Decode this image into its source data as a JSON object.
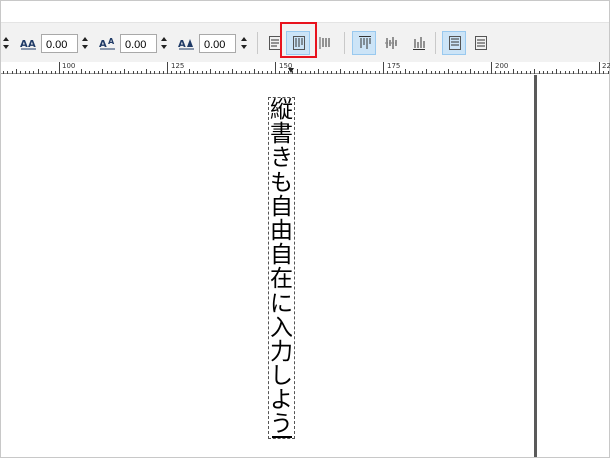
{
  "toolbar": {
    "spacing_fields": [
      {
        "name": "letter-spacing",
        "value": "0.00",
        "icon": "letter-spacing-icon"
      },
      {
        "name": "word-spacing",
        "value": "0.00",
        "icon": "word-spacing-icon"
      },
      {
        "name": "kerning",
        "value": "0.00",
        "icon": "kerning-icon"
      }
    ],
    "buttons": [
      {
        "name": "horizontal-text-button",
        "icon": "horizontal-text-icon",
        "active": false
      },
      {
        "name": "vertical-text-button",
        "icon": "vertical-text-icon",
        "active": true,
        "highlighted": true
      },
      {
        "name": "vertical-text-rtl-button",
        "icon": "vertical-text-rtl-icon",
        "active": false
      },
      {
        "name": "align-top-button",
        "icon": "align-top-icon",
        "active": true
      },
      {
        "name": "align-center-button",
        "icon": "align-center-icon",
        "active": false
      },
      {
        "name": "align-bottom-button",
        "icon": "align-bottom-icon",
        "active": false
      },
      {
        "name": "text-orientation-upright-button",
        "icon": "upright-orientation-icon",
        "active": true
      },
      {
        "name": "text-orientation-sideways-button",
        "icon": "sideways-orientation-icon",
        "active": false
      }
    ],
    "highlight_color": "#e8131d",
    "active_color": "#cce4f7"
  },
  "ruler": {
    "labels": [
      "100",
      "125",
      "150",
      "175",
      "200",
      "22"
    ]
  },
  "canvas": {
    "text_chars": [
      "縦",
      "書",
      "き",
      "も",
      "自",
      "由",
      "自",
      "在",
      "に",
      "入",
      "力",
      "し",
      "よ",
      "う"
    ]
  }
}
